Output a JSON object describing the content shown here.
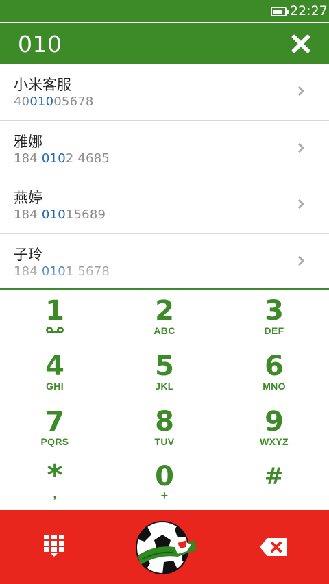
{
  "status_bar": {
    "time": "22:27",
    "battery_level": 0.85
  },
  "search": {
    "query": "010"
  },
  "results": [
    {
      "name": "小米客服",
      "number_before": "40",
      "number_match": "010",
      "number_after": "05678"
    },
    {
      "name": "雅娜",
      "number_before": "184 ",
      "number_match": "010",
      "number_after": "2 4685"
    },
    {
      "name": "燕婷",
      "number_before": "184 ",
      "number_match": "010",
      "number_after": "15689"
    },
    {
      "name": "子玲",
      "number_before": "184 ",
      "number_match": "010",
      "number_after": "1 5678"
    }
  ],
  "keypad": {
    "keys": [
      {
        "digit": "1",
        "letters": ""
      },
      {
        "digit": "2",
        "letters": "ABC"
      },
      {
        "digit": "3",
        "letters": "DEF"
      },
      {
        "digit": "4",
        "letters": "GHI"
      },
      {
        "digit": "5",
        "letters": "JKL"
      },
      {
        "digit": "6",
        "letters": "MNO"
      },
      {
        "digit": "7",
        "letters": "PQRS"
      },
      {
        "digit": "8",
        "letters": "TUV"
      },
      {
        "digit": "9",
        "letters": "WXYZ"
      },
      {
        "digit": "*",
        "letters": ","
      },
      {
        "digit": "0",
        "letters": "+"
      },
      {
        "digit": "#",
        "letters": ""
      }
    ]
  },
  "actions": {
    "dialpad_icon": "dialpad-toggle-icon",
    "call_icon": "soccer-ball-call-icon",
    "delete_icon": "backspace-icon"
  },
  "colors": {
    "primary_green": "#3d8a29",
    "accent_red": "#e8261d",
    "match_blue": "#1f68b8"
  }
}
